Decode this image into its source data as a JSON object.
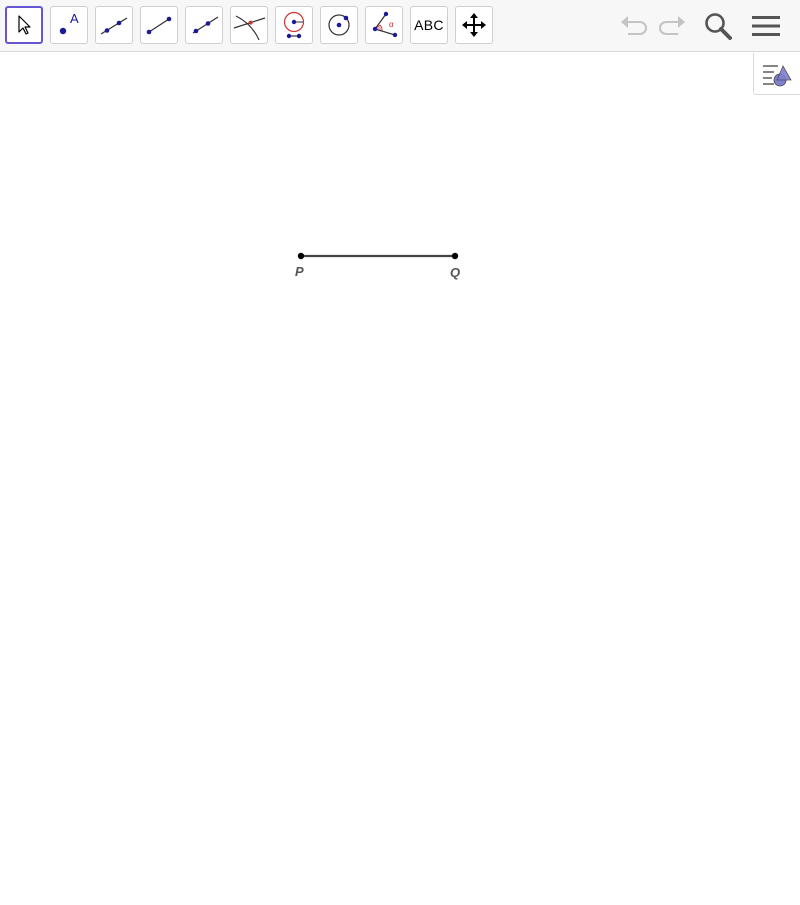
{
  "toolbar": {
    "tools": [
      {
        "name": "move",
        "icon": "cursor-arrow-icon"
      },
      {
        "name": "point",
        "icon": "point-icon",
        "label": "A"
      },
      {
        "name": "line",
        "icon": "line-through-points-icon"
      },
      {
        "name": "segment",
        "icon": "segment-icon"
      },
      {
        "name": "ray",
        "icon": "ray-icon"
      },
      {
        "name": "intersect",
        "icon": "intersect-icon"
      },
      {
        "name": "compass",
        "icon": "compass-circle-icon"
      },
      {
        "name": "circle",
        "icon": "circle-center-point-icon"
      },
      {
        "name": "angle",
        "icon": "angle-icon",
        "label": "α"
      },
      {
        "name": "text",
        "icon": "text-icon",
        "label": "ABC"
      },
      {
        "name": "move-graphics",
        "icon": "move-graphics-icon"
      }
    ],
    "right": [
      "undo-icon",
      "redo-icon",
      "search-icon",
      "menu-icon"
    ]
  },
  "style_bar": {
    "icon": "style-bar-toggle-icon"
  },
  "canvas": {
    "points": [
      {
        "label": "P"
      },
      {
        "label": "Q"
      }
    ],
    "segment": {
      "from": "P",
      "to": "Q"
    }
  },
  "colors": {
    "active_border": "#6557d2",
    "point_blue": "#1a1a99",
    "angle_red": "#cc3333",
    "segment": "#444444"
  }
}
